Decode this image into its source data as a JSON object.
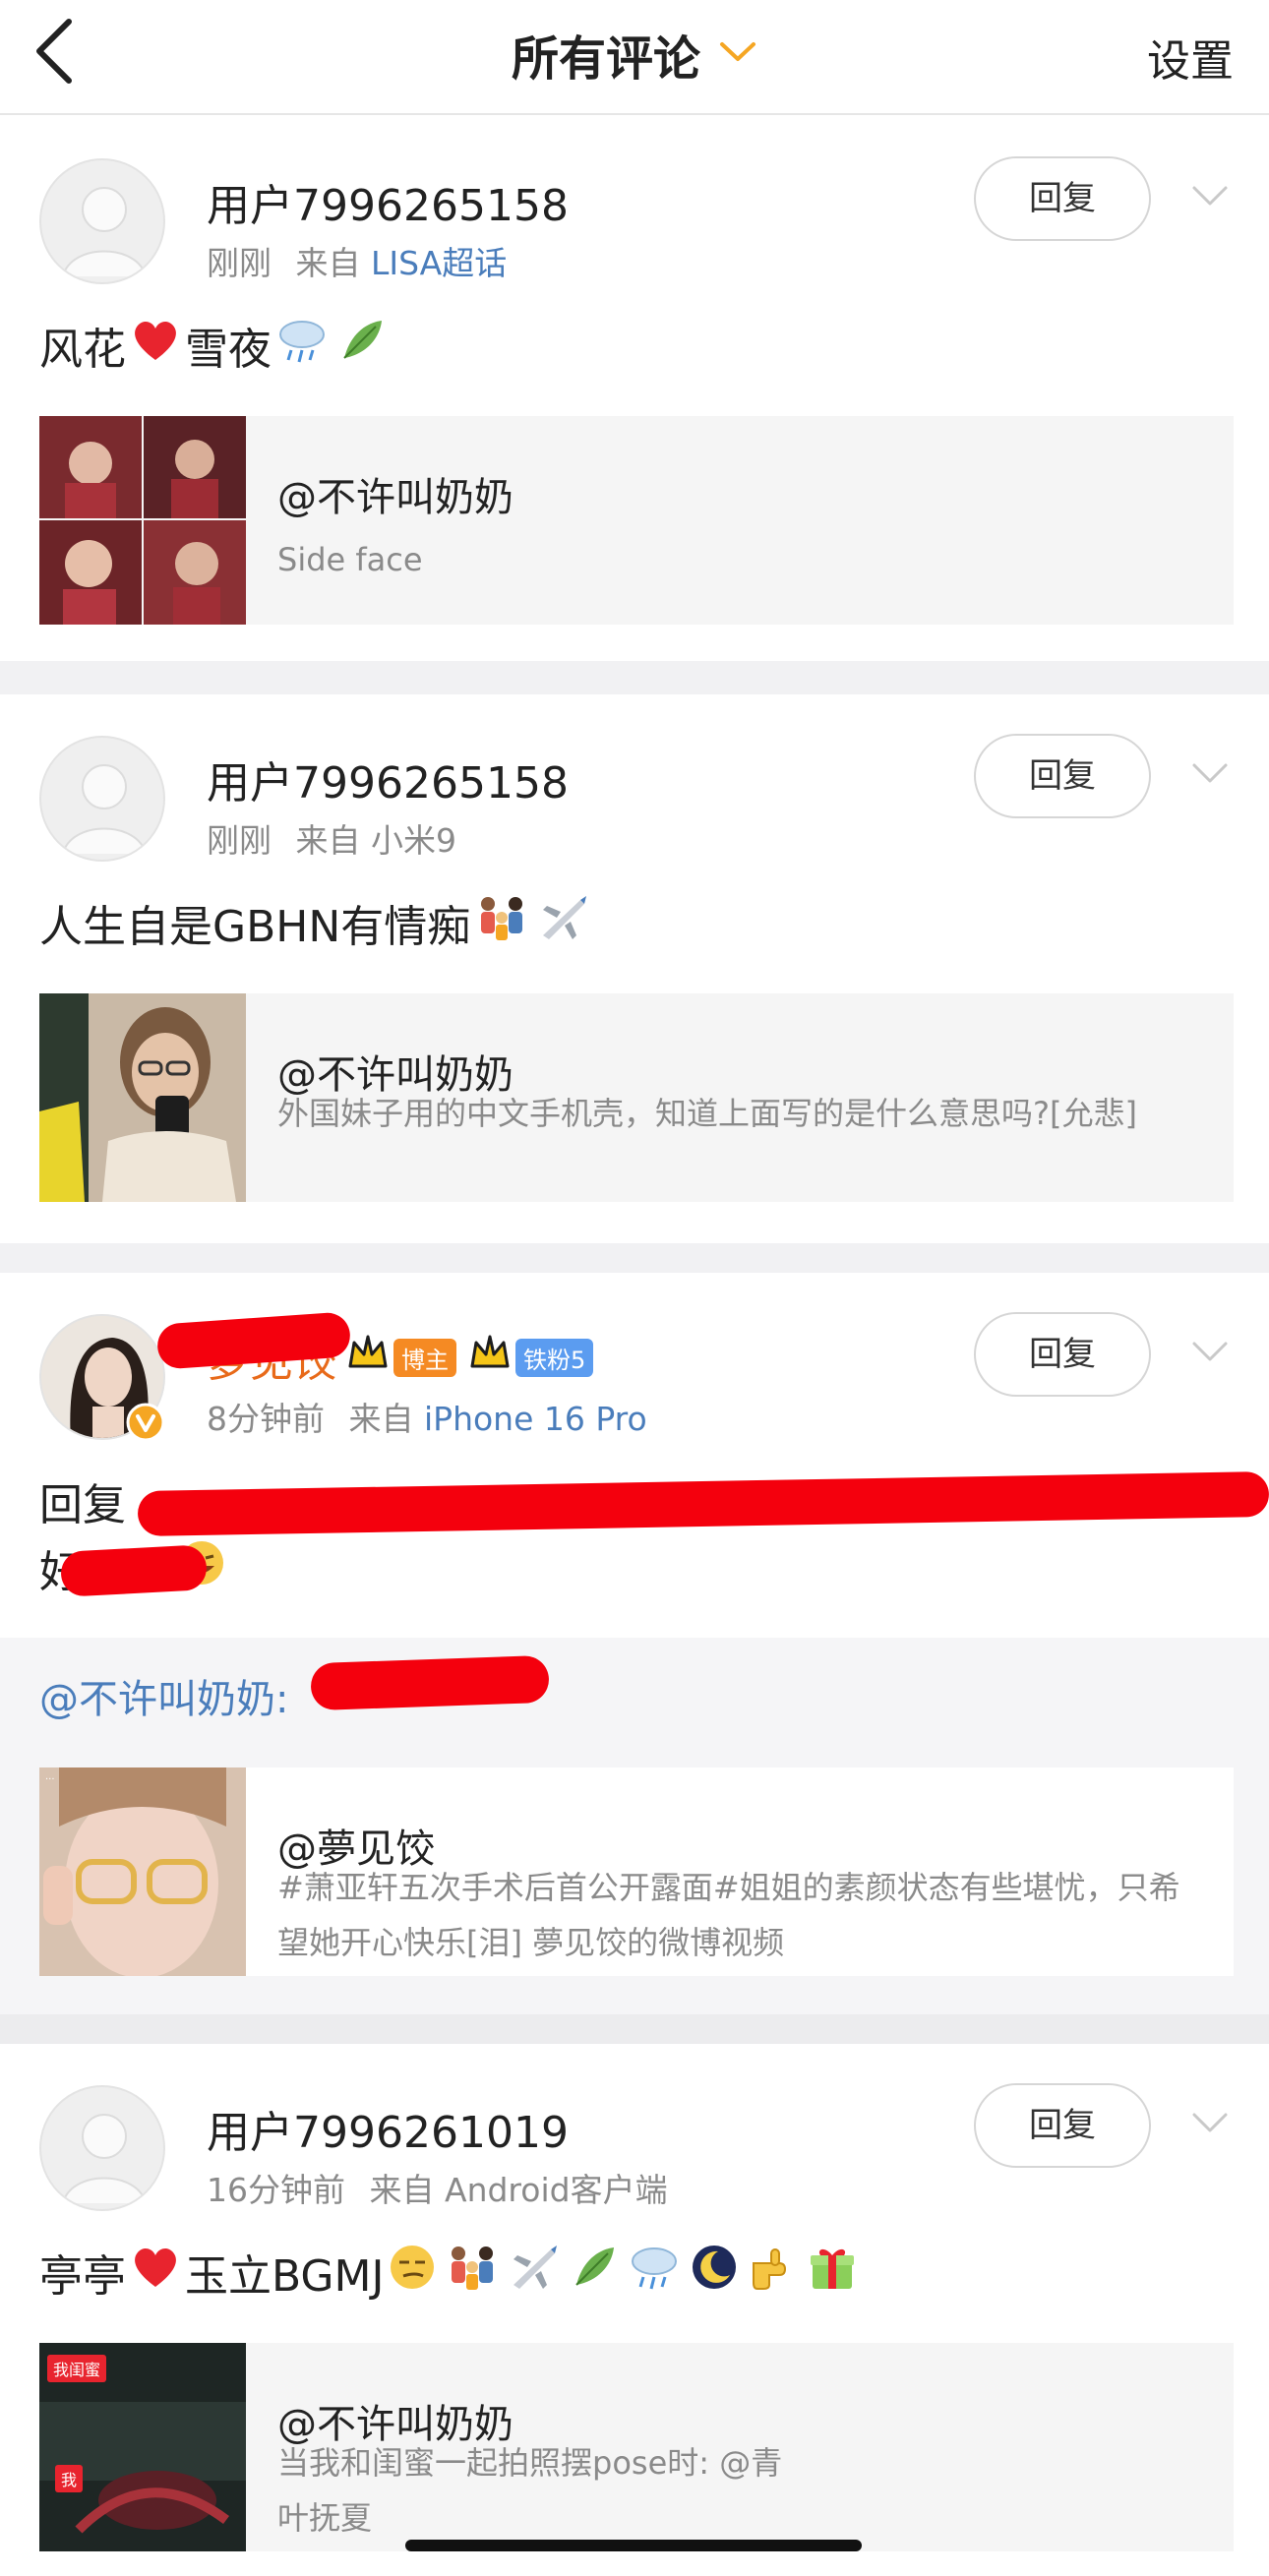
{
  "header": {
    "title": "所有评论",
    "settings_label": "设置"
  },
  "colors": {
    "link": "#4a7dbb",
    "accent": "#f5a623",
    "heart": "#e8242e",
    "redaction": "#f4000d"
  },
  "comments": [
    {
      "username": "用户7996265158",
      "time": "刚刚",
      "source_prefix": "来自",
      "source": "LISA超话",
      "text_parts": [
        "风花",
        "雪夜"
      ],
      "emojis": [
        "heart",
        "rain-cloud",
        "leaf"
      ],
      "reply_label": "回复",
      "card": {
        "name": "@不许叫奶奶",
        "desc": "Side face"
      }
    },
    {
      "username": "用户7996265158",
      "time": "刚刚",
      "source_prefix": "来自",
      "source": "小米9",
      "text": "人生自是GBHN有情痴",
      "emojis": [
        "family",
        "airplane"
      ],
      "reply_label": "回复",
      "card": {
        "name": "@不许叫奶奶",
        "desc": "外国妹子用的中文手机壳，知道上面写的是什么意思吗?[允悲]"
      }
    },
    {
      "username": "萝见饺",
      "badges": [
        "博主",
        "铁粉5"
      ],
      "time": "8分钟前",
      "source_prefix": "来自",
      "source": "iPhone 16 Pro",
      "text_line1": "回复",
      "text_line2": "好",
      "reply_label": "回复",
      "mention": "@不许叫奶奶:",
      "card": {
        "name": "@夢见饺",
        "desc": "#萧亚轩五次手术后首公开露面#姐姐的素颜状态有些堪忧，只希望她开心快乐[泪] 夢见饺的微博视频"
      }
    },
    {
      "username": "用户7996261019",
      "time": "16分钟前",
      "source_prefix": "来自",
      "source": "Android客户端",
      "text_parts": [
        "亭亭",
        "玉立BGMJ"
      ],
      "emojis": [
        "heart",
        "smirk",
        "family",
        "airplane",
        "leaf",
        "rain-cloud",
        "moon",
        "pointing-hand",
        "gift"
      ],
      "reply_label": "回复",
      "card": {
        "name": "@不许叫奶奶",
        "desc": "当我和闺蜜一起拍照摆pose时: @青叶抚夏",
        "thumb_tags": [
          "我闺蜜",
          "我"
        ]
      }
    }
  ]
}
